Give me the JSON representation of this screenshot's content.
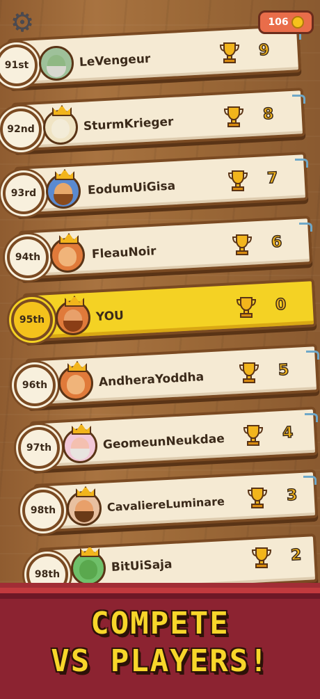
{
  "hud": {
    "coins": "106",
    "settings_icon": "gear-icon",
    "coin_icon": "coin-icon"
  },
  "leaderboard": [
    {
      "rank": "91st",
      "name": "LeVengeur",
      "score": "9"
    },
    {
      "rank": "92nd",
      "name": "SturmKrieger",
      "score": "8"
    },
    {
      "rank": "93rd",
      "name": "EodumUiGisa",
      "score": "7"
    },
    {
      "rank": "94th",
      "name": "FleauNoir",
      "score": "6"
    },
    {
      "rank": "95th",
      "name": "YOU",
      "score": "0"
    },
    {
      "rank": "96th",
      "name": "AndheraYoddha",
      "score": "5"
    },
    {
      "rank": "97th",
      "name": "GeomeunNeukdae",
      "score": "4"
    },
    {
      "rank": "98th",
      "name": "CavaliereLuminare",
      "score": "3"
    },
    {
      "rank": "98th",
      "name": "BitUiSaja",
      "score": "2"
    }
  ],
  "banner": {
    "line1": "COMPETE",
    "line2": "VS PLAYERS!"
  },
  "colors": {
    "highlight": "#f4d224",
    "plank": "#f5ead3",
    "banner": "#8c2331",
    "banner_text": "#f7d62a",
    "coin_badge": "#e96d4a"
  }
}
